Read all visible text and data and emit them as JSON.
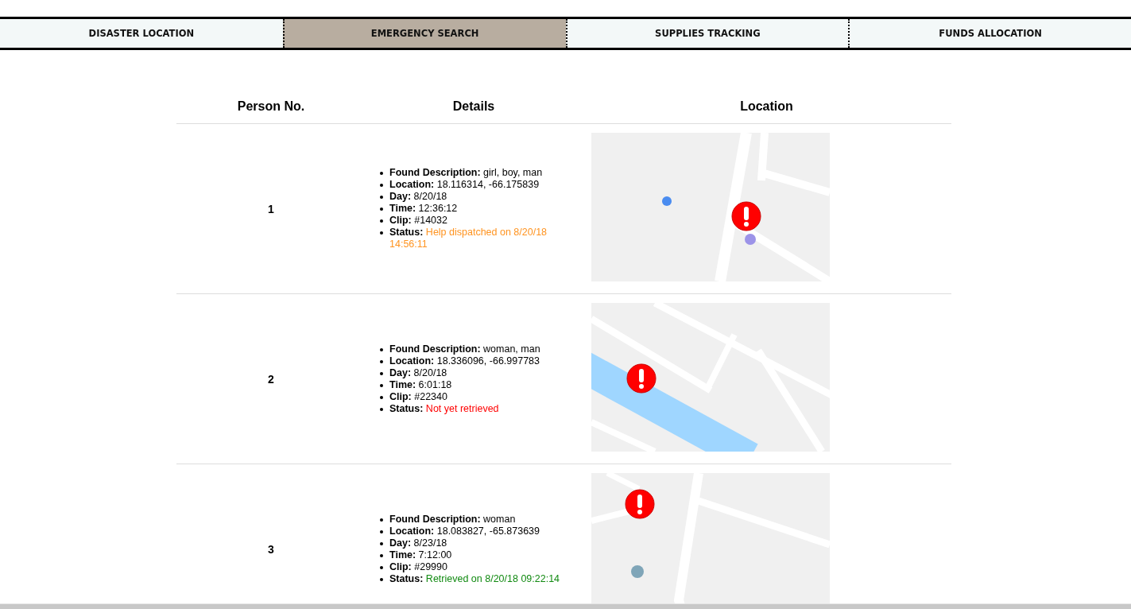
{
  "tabs": [
    {
      "label": "DISASTER LOCATION",
      "selected": false
    },
    {
      "label": "EMERGENCY SEARCH",
      "selected": true
    },
    {
      "label": "SUPPLIES TRACKING",
      "selected": false
    },
    {
      "label": "FUNDS ALLOCATION",
      "selected": false
    }
  ],
  "table": {
    "columns": [
      "Person No.",
      "Details",
      "Location"
    ],
    "rows": [
      {
        "number": "1",
        "details": [
          {
            "label": "Found Description:",
            "value": "girl, boy, man"
          },
          {
            "label": "Location:",
            "value": "18.116314, -66.175839"
          },
          {
            "label": "Day:",
            "value": "8/20/18"
          },
          {
            "label": "Time:",
            "value": "12:36:12"
          },
          {
            "label": "Clip:",
            "value": "#14032"
          }
        ],
        "status": {
          "label": "Status:",
          "value": "Help dispatched on 8/20/18 14:56:11",
          "color": "#ff9421"
        }
      },
      {
        "number": "2",
        "details": [
          {
            "label": "Found Description:",
            "value": "woman, man"
          },
          {
            "label": "Location:",
            "value": "18.336096, -66.997783"
          },
          {
            "label": "Day:",
            "value": "8/20/18"
          },
          {
            "label": "Time:",
            "value": "6:01:18"
          },
          {
            "label": "Clip:",
            "value": "#22340"
          }
        ],
        "status": {
          "label": "Status:",
          "value": "Not yet retrieved",
          "color": "#ff0000"
        }
      },
      {
        "number": "3",
        "details": [
          {
            "label": "Found Description:",
            "value": "woman"
          },
          {
            "label": "Location:",
            "value": "18.083827, -65.873639"
          },
          {
            "label": "Day:",
            "value": "8/23/18"
          },
          {
            "label": "Time:",
            "value": "7:12:00"
          },
          {
            "label": "Clip:",
            "value": "#29990"
          }
        ],
        "status": {
          "label": "Status:",
          "value": "Retrieved on 8/20/18 09:22:14",
          "color": "#118a11"
        }
      }
    ]
  }
}
